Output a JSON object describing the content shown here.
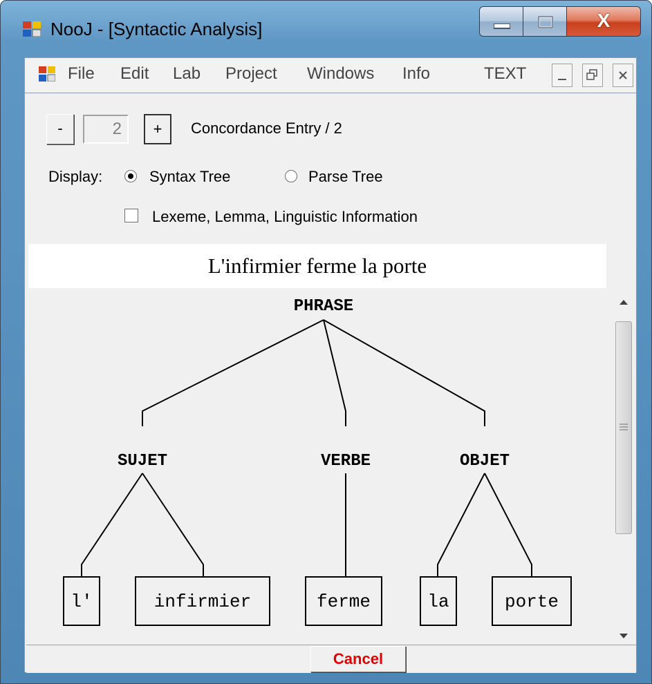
{
  "window": {
    "title": "NooJ - [Syntactic Analysis]",
    "minimize_glyph": "minimize-icon",
    "maximize_glyph": "maximize-icon",
    "close_label": "X"
  },
  "menu": {
    "items": [
      "File",
      "Edit",
      "Lab",
      "Project",
      "Windows",
      "Info",
      "TEXT"
    ]
  },
  "nav": {
    "prev_label": "-",
    "entry_value": "2",
    "next_label": "+",
    "entry_text": "Concordance Entry / 2"
  },
  "display": {
    "label": "Display:",
    "options": [
      "Syntax Tree",
      "Parse Tree"
    ],
    "selected": "Syntax Tree",
    "checkbox_label": "Lexeme, Lemma, Linguistic Information",
    "checkbox_checked": false
  },
  "sentence": "L'infirmier ferme la porte",
  "tree": {
    "root": "PHRASE",
    "constituents": [
      "SUJET",
      "VERBE",
      "OBJET"
    ],
    "words": [
      "l'",
      "infirmier",
      "ferme",
      "la",
      "porte"
    ]
  },
  "footer": {
    "cancel_label": "Cancel"
  },
  "colors": {
    "cancel_text": "#e00000",
    "title_gradient": "#5f97c4"
  }
}
